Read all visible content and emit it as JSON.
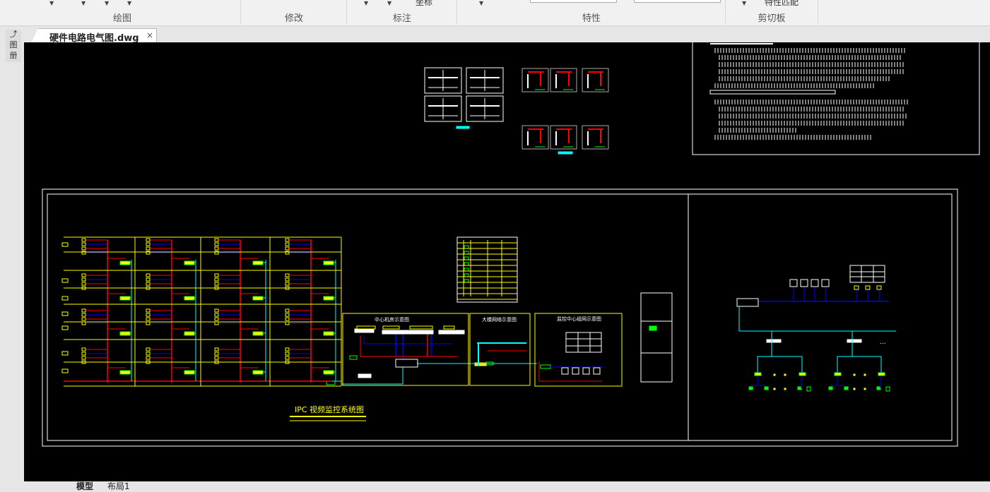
{
  "ribbon": {
    "groups": [
      {
        "label": "绘图"
      },
      {
        "label": "修改"
      },
      {
        "label": "标注"
      },
      {
        "label": "特性"
      },
      {
        "label": "剪切板"
      }
    ],
    "partial_labels": {
      "coordinate": "坐标",
      "match_properties": "特性匹配"
    }
  },
  "document_tab": {
    "title": "硬件电路电气图.dwg",
    "close": "×"
  },
  "left_toolbar": {
    "items": [
      "⤴",
      "图",
      "册"
    ]
  },
  "layout_tabs": [
    {
      "label": "模型",
      "active": true
    },
    {
      "label": "布局1",
      "active": false
    }
  ],
  "drawing": {
    "title": "IPC 视频监控系统图",
    "panel_titles": [
      "中心机房示意图",
      "大楼网络示意图",
      "监控中心组网示意图"
    ],
    "ellipsis": "..."
  },
  "colors": {
    "canvas": "#000000",
    "yellow": "#ffff00",
    "red": "#ff0000",
    "blue": "#0000ff",
    "cyan": "#00ffff",
    "green": "#00ff00",
    "white": "#ffffff"
  }
}
